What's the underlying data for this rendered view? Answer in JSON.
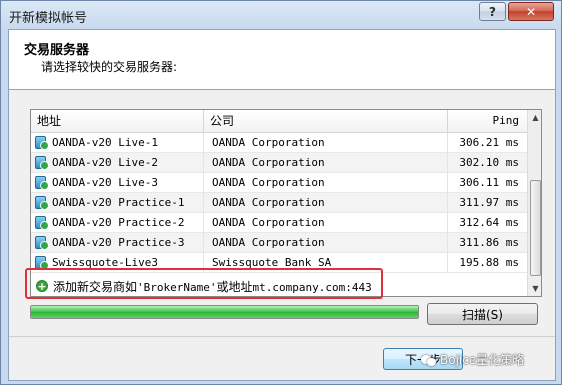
{
  "window": {
    "title": "开新模拟帐号",
    "help_label": "?",
    "close_label": "✕"
  },
  "header": {
    "title": "交易服务器",
    "subtitle": "请选择较快的交易服务器:"
  },
  "table": {
    "columns": {
      "address": "地址",
      "company": "公司",
      "ping": "Ping"
    },
    "rows": [
      {
        "address": "OANDA-v20 Live-1",
        "company": "OANDA Corporation",
        "ping": "306.21 ms"
      },
      {
        "address": "OANDA-v20 Live-2",
        "company": "OANDA Corporation",
        "ping": "302.10 ms"
      },
      {
        "address": "OANDA-v20 Live-3",
        "company": "OANDA Corporation",
        "ping": "306.11 ms"
      },
      {
        "address": "OANDA-v20 Practice-1",
        "company": "OANDA Corporation",
        "ping": "311.97 ms"
      },
      {
        "address": "OANDA-v20 Practice-2",
        "company": "OANDA Corporation",
        "ping": "312.64 ms"
      },
      {
        "address": "OANDA-v20 Practice-3",
        "company": "OANDA Corporation",
        "ping": "311.86 ms"
      },
      {
        "address": "Swissquote-Live3",
        "company": "Swissquote Bank SA",
        "ping": "195.88 ms"
      }
    ],
    "add_prefix": "添加新交易商如",
    "add_example_name": "'BrokerName'",
    "add_middle": "或地址",
    "add_example_addr": "mt.company.com:443"
  },
  "progress": {
    "value_percent": 100
  },
  "buttons": {
    "scan": "扫描(S)",
    "next": "下一步"
  },
  "watermark": {
    "text": "Bojice量化策略"
  },
  "colors": {
    "accent_green": "#39c43f",
    "highlight_red": "#e0303a",
    "server_icon_blue": "#2c8fc6"
  },
  "icons": {
    "server": "server-status-icon",
    "add": "add-plus-icon",
    "help": "help-icon",
    "close": "close-icon"
  }
}
